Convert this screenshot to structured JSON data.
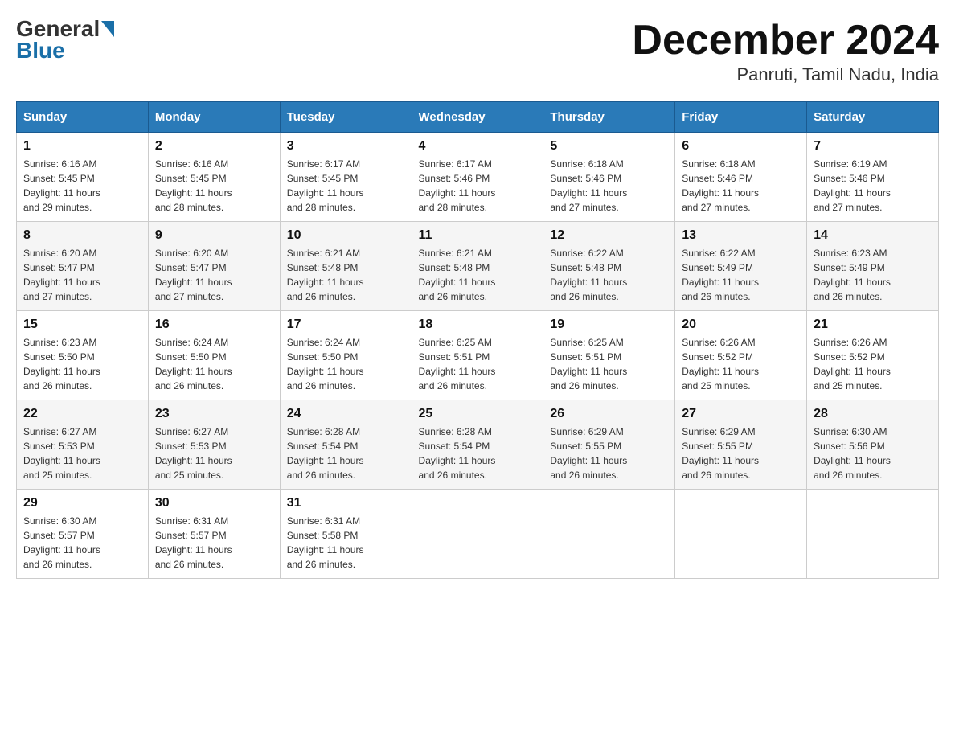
{
  "header": {
    "logo": {
      "part1": "General",
      "part2": "Blue"
    },
    "month_title": "December 2024",
    "location": "Panruti, Tamil Nadu, India"
  },
  "days_of_week": [
    "Sunday",
    "Monday",
    "Tuesday",
    "Wednesday",
    "Thursday",
    "Friday",
    "Saturday"
  ],
  "weeks": [
    [
      {
        "day": "1",
        "sunrise": "6:16 AM",
        "sunset": "5:45 PM",
        "daylight": "11 hours and 29 minutes."
      },
      {
        "day": "2",
        "sunrise": "6:16 AM",
        "sunset": "5:45 PM",
        "daylight": "11 hours and 28 minutes."
      },
      {
        "day": "3",
        "sunrise": "6:17 AM",
        "sunset": "5:45 PM",
        "daylight": "11 hours and 28 minutes."
      },
      {
        "day": "4",
        "sunrise": "6:17 AM",
        "sunset": "5:46 PM",
        "daylight": "11 hours and 28 minutes."
      },
      {
        "day": "5",
        "sunrise": "6:18 AM",
        "sunset": "5:46 PM",
        "daylight": "11 hours and 27 minutes."
      },
      {
        "day": "6",
        "sunrise": "6:18 AM",
        "sunset": "5:46 PM",
        "daylight": "11 hours and 27 minutes."
      },
      {
        "day": "7",
        "sunrise": "6:19 AM",
        "sunset": "5:46 PM",
        "daylight": "11 hours and 27 minutes."
      }
    ],
    [
      {
        "day": "8",
        "sunrise": "6:20 AM",
        "sunset": "5:47 PM",
        "daylight": "11 hours and 27 minutes."
      },
      {
        "day": "9",
        "sunrise": "6:20 AM",
        "sunset": "5:47 PM",
        "daylight": "11 hours and 27 minutes."
      },
      {
        "day": "10",
        "sunrise": "6:21 AM",
        "sunset": "5:48 PM",
        "daylight": "11 hours and 26 minutes."
      },
      {
        "day": "11",
        "sunrise": "6:21 AM",
        "sunset": "5:48 PM",
        "daylight": "11 hours and 26 minutes."
      },
      {
        "day": "12",
        "sunrise": "6:22 AM",
        "sunset": "5:48 PM",
        "daylight": "11 hours and 26 minutes."
      },
      {
        "day": "13",
        "sunrise": "6:22 AM",
        "sunset": "5:49 PM",
        "daylight": "11 hours and 26 minutes."
      },
      {
        "day": "14",
        "sunrise": "6:23 AM",
        "sunset": "5:49 PM",
        "daylight": "11 hours and 26 minutes."
      }
    ],
    [
      {
        "day": "15",
        "sunrise": "6:23 AM",
        "sunset": "5:50 PM",
        "daylight": "11 hours and 26 minutes."
      },
      {
        "day": "16",
        "sunrise": "6:24 AM",
        "sunset": "5:50 PM",
        "daylight": "11 hours and 26 minutes."
      },
      {
        "day": "17",
        "sunrise": "6:24 AM",
        "sunset": "5:50 PM",
        "daylight": "11 hours and 26 minutes."
      },
      {
        "day": "18",
        "sunrise": "6:25 AM",
        "sunset": "5:51 PM",
        "daylight": "11 hours and 26 minutes."
      },
      {
        "day": "19",
        "sunrise": "6:25 AM",
        "sunset": "5:51 PM",
        "daylight": "11 hours and 26 minutes."
      },
      {
        "day": "20",
        "sunrise": "6:26 AM",
        "sunset": "5:52 PM",
        "daylight": "11 hours and 25 minutes."
      },
      {
        "day": "21",
        "sunrise": "6:26 AM",
        "sunset": "5:52 PM",
        "daylight": "11 hours and 25 minutes."
      }
    ],
    [
      {
        "day": "22",
        "sunrise": "6:27 AM",
        "sunset": "5:53 PM",
        "daylight": "11 hours and 25 minutes."
      },
      {
        "day": "23",
        "sunrise": "6:27 AM",
        "sunset": "5:53 PM",
        "daylight": "11 hours and 25 minutes."
      },
      {
        "day": "24",
        "sunrise": "6:28 AM",
        "sunset": "5:54 PM",
        "daylight": "11 hours and 26 minutes."
      },
      {
        "day": "25",
        "sunrise": "6:28 AM",
        "sunset": "5:54 PM",
        "daylight": "11 hours and 26 minutes."
      },
      {
        "day": "26",
        "sunrise": "6:29 AM",
        "sunset": "5:55 PM",
        "daylight": "11 hours and 26 minutes."
      },
      {
        "day": "27",
        "sunrise": "6:29 AM",
        "sunset": "5:55 PM",
        "daylight": "11 hours and 26 minutes."
      },
      {
        "day": "28",
        "sunrise": "6:30 AM",
        "sunset": "5:56 PM",
        "daylight": "11 hours and 26 minutes."
      }
    ],
    [
      {
        "day": "29",
        "sunrise": "6:30 AM",
        "sunset": "5:57 PM",
        "daylight": "11 hours and 26 minutes."
      },
      {
        "day": "30",
        "sunrise": "6:31 AM",
        "sunset": "5:57 PM",
        "daylight": "11 hours and 26 minutes."
      },
      {
        "day": "31",
        "sunrise": "6:31 AM",
        "sunset": "5:58 PM",
        "daylight": "11 hours and 26 minutes."
      },
      null,
      null,
      null,
      null
    ]
  ],
  "labels": {
    "sunrise": "Sunrise:",
    "sunset": "Sunset:",
    "daylight": "Daylight:"
  }
}
